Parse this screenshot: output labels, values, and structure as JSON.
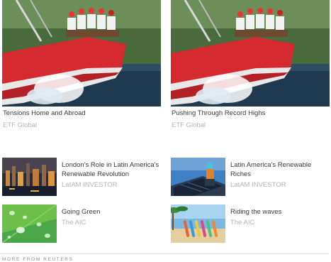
{
  "featured": [
    {
      "title": "Tensions Home and Abroad",
      "source": "ETF Global"
    },
    {
      "title": "Pushing Through Record Highs",
      "source": "ETF Global"
    }
  ],
  "list": [
    {
      "title": "London's Role in Latin America's Renewable Revolution",
      "source": "LatAM INVESTOR"
    },
    {
      "title": "Latin America's Renewable Riches",
      "source": "LatAM INVESTOR"
    },
    {
      "title": "Going Green",
      "source": "The AIC"
    },
    {
      "title": "Riding the waves",
      "source": "The AIC"
    }
  ],
  "footer": {
    "label": "MORE FROM REUTERS"
  }
}
